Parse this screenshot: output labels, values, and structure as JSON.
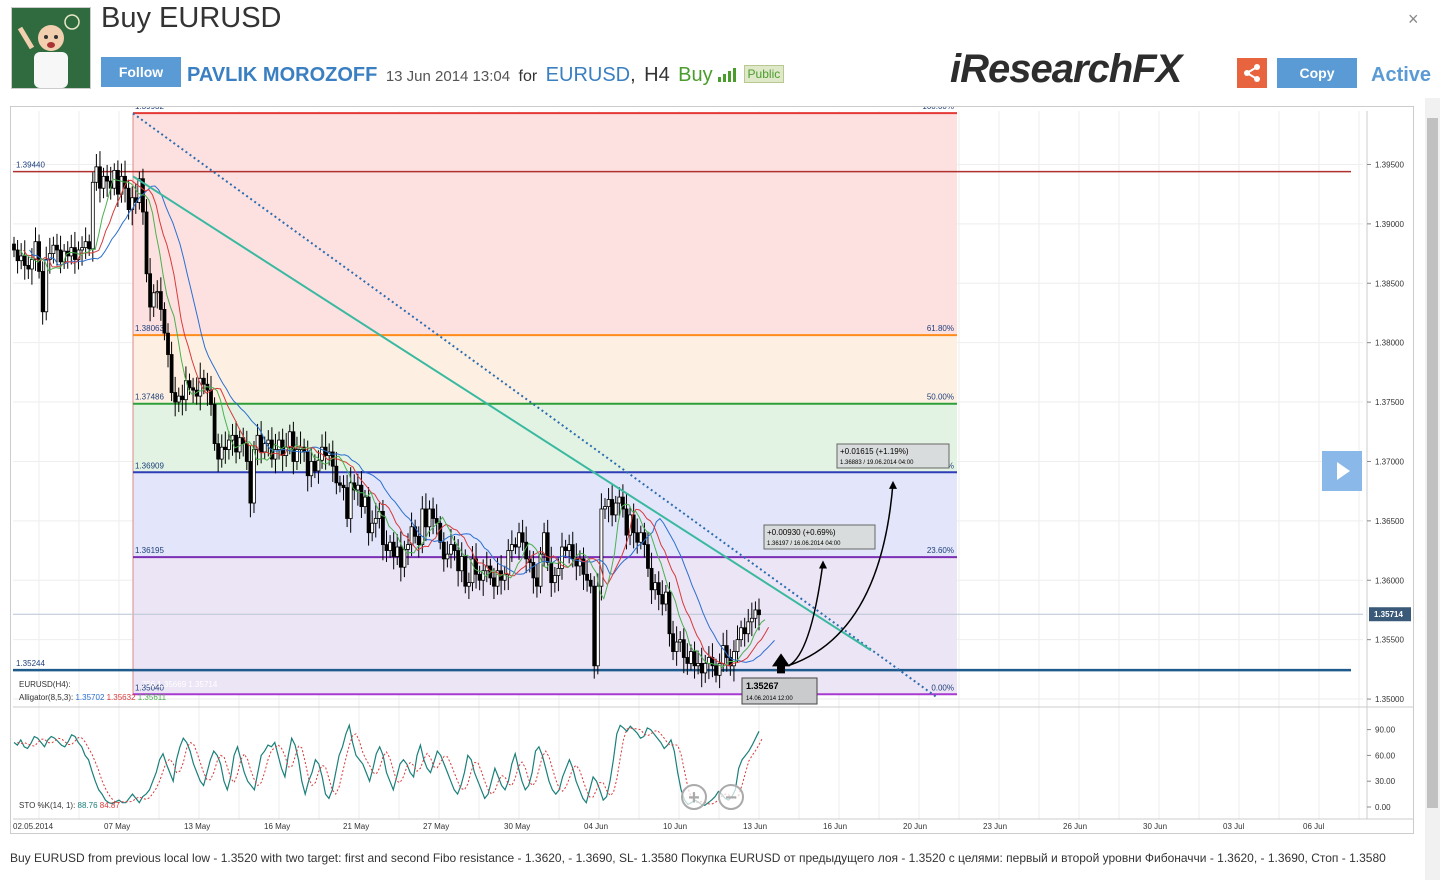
{
  "header": {
    "title": "Buy EURUSD",
    "follow_label": "Follow",
    "author": "PAVLIK MOROZOFF",
    "date": "13 Jun 2014 13:04",
    "for_label": "for",
    "symbol": "EURUSD",
    "timeframe": "H4",
    "direction": "Buy",
    "visibility": "Public",
    "logo": "iResearchFX",
    "copy_label": "Copy",
    "status": "Active",
    "close_icon": "×"
  },
  "footer": {
    "description": "Buy EURUSD from previous local low - 1.3520 with two target: first and second Fibo resistance - 1.3620, - 1.3690, SL- 1.3580 Покупка EURUSD от предыдущего лоя - 1.3520 с целями: первый и второй уровни Фибоначчи - 1.3620, - 1.3690, Стоп - 1.3580"
  },
  "chart_data": {
    "type": "candlestick",
    "symbol_label": "EURUSD(H4):",
    "alligator_label": "Alligator(8,5,3):",
    "alligator_values": [
      "1.35702",
      "1.35632",
      "1.35611"
    ],
    "ohlc_fragment": [
      "...756",
      "1.35669",
      "1.35714"
    ],
    "stoch_label": "STO %K(14, 1):",
    "stoch_values": [
      "88.76",
      "84.87"
    ],
    "current_price": "1.35714",
    "y_ticks": [
      "1.39500",
      "1.39000",
      "1.38500",
      "1.38000",
      "1.37500",
      "1.37000",
      "1.36500",
      "1.36000",
      "1.35500",
      "1.35000"
    ],
    "ylim": [
      1.3495,
      1.3995
    ],
    "stoch_ticks": [
      "90.00",
      "60.00",
      "30.00",
      "0.00"
    ],
    "x_ticks": [
      "02.05.2014",
      "07 May",
      "13 May",
      "16 May",
      "21 May",
      "27 May",
      "30 May",
      "04 Jun",
      "10 Jun",
      "13 Jun",
      "16 Jun",
      "20 Jun",
      "23 Jun",
      "26 Jun",
      "30 Jun",
      "03 Jul",
      "06 Jul"
    ],
    "fib_levels": [
      {
        "price": 1.39932,
        "label": "1.39932",
        "pct": "100.00%",
        "color": "#e53935"
      },
      {
        "price": 1.38063,
        "label": "1.38063",
        "pct": "61.80%",
        "color": "#ff8c1a"
      },
      {
        "price": 1.37486,
        "label": "1.37486",
        "pct": "50.00%",
        "color": "#2e9e3a"
      },
      {
        "price": 1.36909,
        "label": "1.36909",
        "pct": "38.20%",
        "color": "#2e3db8"
      },
      {
        "price": 1.36195,
        "label": "1.36195",
        "pct": "23.60%",
        "color": "#7b2fb5"
      },
      {
        "price": 1.3504,
        "label": "1.35040",
        "pct": "0.00%",
        "color": "#a93ad1"
      }
    ],
    "h_lines": [
      {
        "price": 1.3944,
        "label": "1.39440",
        "color": "#b03030"
      },
      {
        "price": 1.35244,
        "label": "1.35244",
        "color": "#1e5a8c"
      }
    ],
    "entry": {
      "price": "1.35267",
      "date": "14.06.2014 12:00"
    },
    "targets": [
      {
        "change": "+0.00930 (+0.69%)",
        "price": "1.36197",
        "date": "16.06.2014 04:00"
      },
      {
        "change": "+0.01615 (+1.19%)",
        "price": "1.36883",
        "date": "19.06.2014 04:00"
      }
    ],
    "closes": [
      1.3878,
      1.3869,
      1.3873,
      1.3865,
      1.3862,
      1.387,
      1.3885,
      1.386,
      1.3826,
      1.387,
      1.3875,
      1.3882,
      1.3878,
      1.3868,
      1.3877,
      1.3873,
      1.388,
      1.387,
      1.3878,
      1.388,
      1.3885,
      1.3879,
      1.3935,
      1.3948,
      1.393,
      1.394,
      1.3936,
      1.393,
      1.3945,
      1.3925,
      1.394,
      1.393,
      1.3912,
      1.3922,
      1.3918,
      1.3938,
      1.391,
      1.3858,
      1.383,
      1.3842,
      1.3843,
      1.3828,
      1.3808,
      1.379,
      1.3758,
      1.375,
      1.3755,
      1.3752,
      1.3768,
      1.3762,
      1.376,
      1.3755,
      1.377,
      1.3765,
      1.376,
      1.3748,
      1.3715,
      1.3702,
      1.3712,
      1.371,
      1.3718,
      1.3722,
      1.3708,
      1.372,
      1.3715,
      1.37,
      1.3665,
      1.371,
      1.3722,
      1.3708,
      1.3715,
      1.3718,
      1.3702,
      1.371,
      1.3718,
      1.3705,
      1.3712,
      1.3725,
      1.37,
      1.371,
      1.3712,
      1.3708,
      1.3688,
      1.37,
      1.3692,
      1.3701,
      1.3712,
      1.3705,
      1.3708,
      1.3696,
      1.3682,
      1.368,
      1.3678,
      1.3652,
      1.3682,
      1.3676,
      1.368,
      1.3662,
      1.367,
      1.364,
      1.3648,
      1.3652,
      1.3658,
      1.363,
      1.3625,
      1.3632,
      1.362,
      1.3628,
      1.3611,
      1.3626,
      1.363,
      1.3645,
      1.3637,
      1.363,
      1.366,
      1.3645,
      1.366,
      1.3652,
      1.3648,
      1.3632,
      1.3618,
      1.3622,
      1.363,
      1.3625,
      1.3608,
      1.362,
      1.3595,
      1.3598,
      1.3618,
      1.3605,
      1.36,
      1.3608,
      1.3612,
      1.3602,
      1.3595,
      1.3608,
      1.36,
      1.3605,
      1.3625,
      1.363,
      1.3628,
      1.364,
      1.3632,
      1.3618,
      1.3615,
      1.3602,
      1.3595,
      1.3622,
      1.364,
      1.3615,
      1.3598,
      1.3604,
      1.361,
      1.3628,
      1.3625,
      1.363,
      1.3618,
      1.3612,
      1.3618,
      1.3605,
      1.36,
      1.3595,
      1.3528,
      1.3595,
      1.366,
      1.3662,
      1.3668,
      1.3655,
      1.3665,
      1.367,
      1.366,
      1.3638,
      1.3655,
      1.364,
      1.3632,
      1.364,
      1.363,
      1.361,
      1.3592,
      1.3598,
      1.3588,
      1.358,
      1.359,
      1.3555,
      1.354,
      1.3548,
      1.355,
      1.3535,
      1.353,
      1.354,
      1.3528,
      1.353,
      1.3522,
      1.353,
      1.3535,
      1.3528,
      1.352,
      1.353,
      1.3545,
      1.3535,
      1.3528,
      1.354,
      1.355,
      1.356,
      1.3555,
      1.3565,
      1.3568,
      1.3575,
      1.3571
    ],
    "stoch": [
      75,
      72,
      78,
      70,
      68,
      74,
      82,
      80,
      75,
      70,
      78,
      82,
      80,
      76,
      72,
      70,
      76,
      84,
      82,
      75,
      70,
      60,
      55,
      42,
      30,
      20,
      15,
      8,
      5,
      4,
      6,
      8,
      5,
      5,
      10,
      15,
      10,
      5,
      12,
      15,
      20,
      30,
      40,
      55,
      62,
      50,
      40,
      30,
      55,
      70,
      80,
      75,
      65,
      50,
      40,
      30,
      25,
      40,
      55,
      65,
      60,
      50,
      30,
      20,
      35,
      60,
      70,
      55,
      40,
      30,
      25,
      20,
      40,
      60,
      65,
      72,
      70,
      75,
      60,
      45,
      35,
      60,
      80,
      72,
      55,
      30,
      15,
      30,
      40,
      55,
      50,
      35,
      15,
      10,
      20,
      40,
      60,
      70,
      85,
      95,
      75,
      60,
      55,
      50,
      40,
      30,
      45,
      62,
      70,
      60,
      40,
      30,
      20,
      35,
      50,
      55,
      50,
      40,
      35,
      60,
      72,
      55,
      45,
      40,
      52,
      65,
      60,
      50,
      40,
      30,
      20,
      15,
      25,
      40,
      60,
      55,
      40,
      30,
      20,
      10,
      15,
      30,
      45,
      35,
      25,
      20,
      30,
      50,
      62,
      45,
      30,
      20,
      25,
      40,
      65,
      70,
      60,
      45,
      30,
      20,
      15,
      20,
      35,
      45,
      55,
      45,
      30,
      20,
      10,
      5,
      20,
      35,
      30,
      20,
      8,
      12,
      30,
      55,
      85,
      95,
      92,
      88,
      94,
      90,
      86,
      80,
      82,
      92,
      90,
      85,
      80,
      75,
      68,
      72,
      78,
      65,
      40,
      20,
      8,
      3,
      5,
      8,
      6,
      3,
      2,
      5,
      8,
      12,
      18,
      15,
      10,
      8,
      12,
      20,
      45,
      55,
      60,
      65,
      72,
      80,
      88
    ]
  }
}
